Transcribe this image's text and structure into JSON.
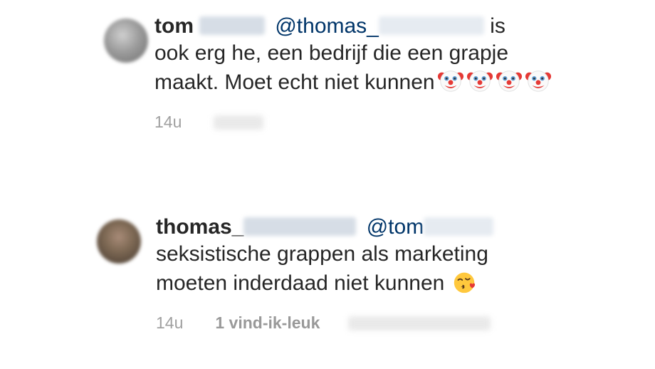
{
  "comments": [
    {
      "username": "tom",
      "mention": "@thomas_",
      "text_inline": " is",
      "text_rest": "ook erg he, een bedrijf die een grapje maakt. Moet echt niet kunnen",
      "emojis": [
        "clown-icon",
        "clown-icon",
        "clown-icon",
        "clown-icon"
      ],
      "time": "14u",
      "likes": ""
    },
    {
      "username": "thomas_",
      "mention": "@tom",
      "text_inline": "",
      "text_rest": "seksistische grappen als marketing moeten inderdaad niet kunnen",
      "emojis": [
        "kiss-emoji-icon"
      ],
      "time": "14u",
      "likes": "1 vind-ik-leuk"
    }
  ]
}
